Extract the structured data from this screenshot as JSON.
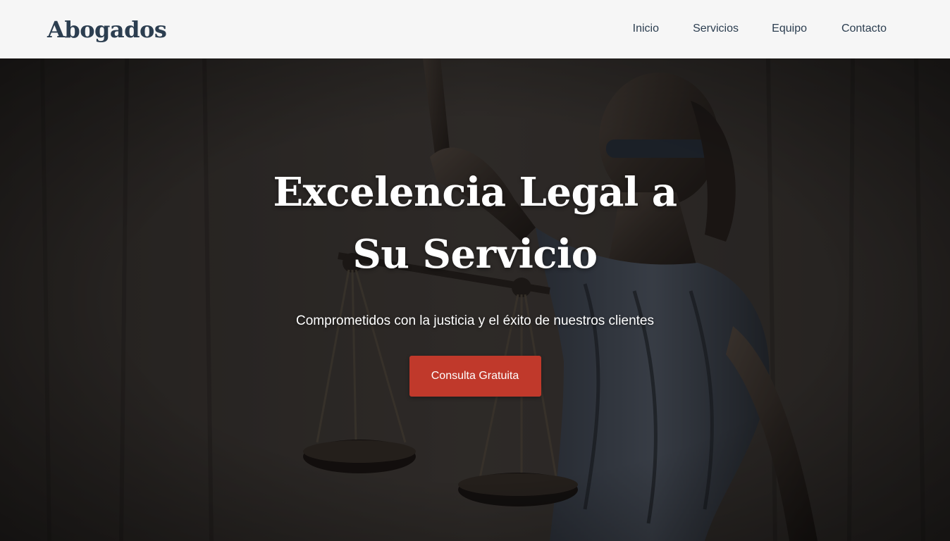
{
  "header": {
    "brand": "Abogados",
    "nav": [
      {
        "label": "Inicio"
      },
      {
        "label": "Servicios"
      },
      {
        "label": "Equipo"
      },
      {
        "label": "Contacto"
      }
    ]
  },
  "hero": {
    "title": "Excelencia Legal a Su Servicio",
    "subtitle": "Comprometidos con la justicia y el éxito de nuestros clientes",
    "cta_label": "Consulta Gratuita",
    "background_icon": "lady-justice-statue-icon"
  },
  "colors": {
    "brand_text": "#2c3e50",
    "nav_text": "#2c3e50",
    "cta_background": "#c0392b",
    "header_background": "#ffffff",
    "hero_text": "#ffffff"
  }
}
